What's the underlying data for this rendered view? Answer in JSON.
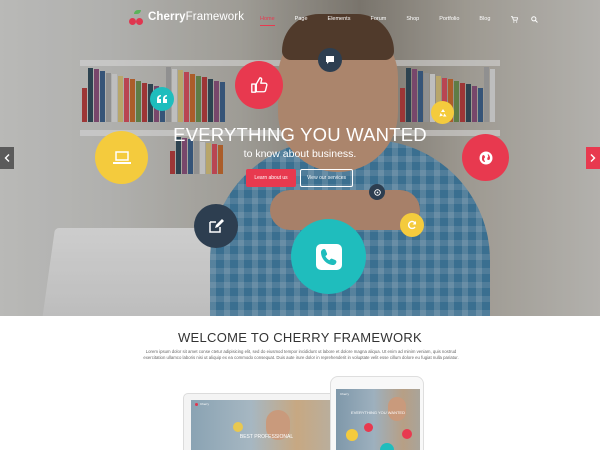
{
  "brand": {
    "name_bold": "Cherry",
    "name_light": "Framework"
  },
  "nav": {
    "items": [
      {
        "label": "Home",
        "active": true
      },
      {
        "label": "Page"
      },
      {
        "label": "Elements"
      },
      {
        "label": "Forum"
      },
      {
        "label": "Shop"
      },
      {
        "label": "Portfolio"
      },
      {
        "label": "Blog"
      }
    ],
    "icons": [
      "cart-icon",
      "search-icon"
    ]
  },
  "hero": {
    "title": "EVERYTHING YOU WANTED",
    "subtitle": "to know about business.",
    "primary_button": "Learn about us",
    "secondary_button": "View our services",
    "bubbles": [
      {
        "name": "thumbs-up-icon",
        "color": "#e8394f"
      },
      {
        "name": "chat-icon",
        "color": "#2d3e50"
      },
      {
        "name": "quote-icon",
        "color": "#1fbdbd"
      },
      {
        "name": "recycle-icon",
        "color": "#f4cb3d"
      },
      {
        "name": "laptop-icon",
        "color": "#f4cb3d"
      },
      {
        "name": "globe-icon",
        "color": "#e8394f"
      },
      {
        "name": "compass-icon",
        "color": "#2d3e50"
      },
      {
        "name": "refresh-icon",
        "color": "#f4cb3d"
      },
      {
        "name": "edit-icon",
        "color": "#2d3e50"
      },
      {
        "name": "phone-icon",
        "color": "#1fbdbd"
      }
    ]
  },
  "welcome": {
    "title": "WELCOME TO CHERRY FRAMEWORK",
    "text": "Lorem ipsum dolor sit amet conse ctetur adipisicing elit, sed do eiusmod tempor incididunt ut labore et dolore magna aliqua. Ut enim ad minim veniam, quis nostrud exercitation ullamco laboris nisi ut aliquip ex ea commodo consequat. Duis aute irure dolor in reprehenderit in voluptate velit esse cillum dolore eu fugiat nulla pariatur."
  },
  "devices": {
    "laptop_caption": "BEST PROFESSIONAL",
    "phone_title": "EVERYTHING YOU WANTED"
  },
  "colors": {
    "accent": "#e8394f",
    "teal": "#1fbdbd",
    "yellow": "#f4cb3d",
    "navy": "#2d3e50"
  }
}
